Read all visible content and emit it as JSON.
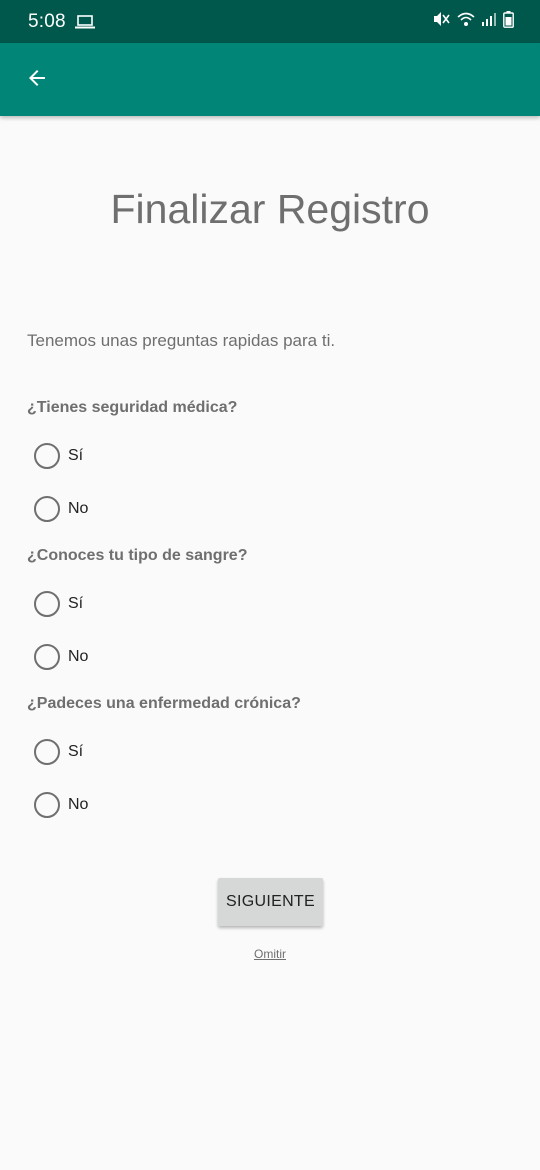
{
  "status_bar": {
    "time": "5:08",
    "icons": [
      "laptop-icon",
      "mute-icon",
      "wifi-icon",
      "signal-icon",
      "battery-icon"
    ]
  },
  "app_bar": {
    "color": "#008577",
    "status_color": "#00574b",
    "back_icon": "arrow-back-icon"
  },
  "page": {
    "title": "Finalizar Registro",
    "intro": "Tenemos unas preguntas rapidas para ti."
  },
  "questions": [
    {
      "text": "¿Tienes seguridad médica?",
      "options": [
        "Sí",
        "No"
      ]
    },
    {
      "text": "¿Conoces tu tipo de sangre?",
      "options": [
        "Sí",
        "No"
      ]
    },
    {
      "text": "¿Padeces una enfermedad crónica?",
      "options": [
        "Sí",
        "No"
      ]
    }
  ],
  "actions": {
    "next_label": "SIGUIENTE",
    "skip_label": "Omitir"
  }
}
